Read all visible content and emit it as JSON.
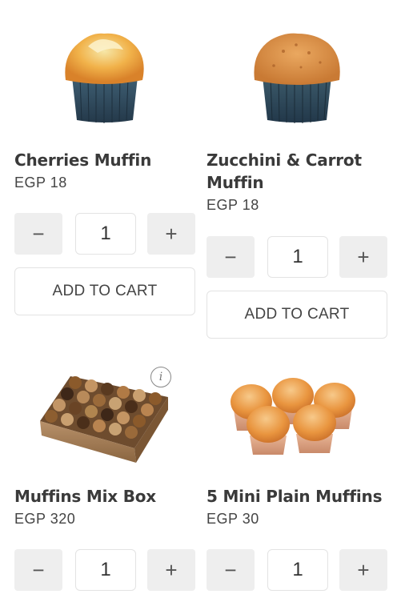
{
  "products": [
    {
      "name": "Cherries Muffin",
      "price": "EGP 18",
      "quantity": "1",
      "minus_icon": "minus-icon",
      "plus_icon": "plus-icon",
      "add_label": "ADD TO CART"
    },
    {
      "name": "Zucchini & Carrot Muffin",
      "price": "EGP 18",
      "quantity": "1",
      "minus_icon": "minus-icon",
      "plus_icon": "plus-icon",
      "add_label": "ADD TO CART"
    },
    {
      "name": "Muffins Mix Box",
      "price": "EGP 320",
      "quantity": "1",
      "info_icon": "info-icon",
      "minus_icon": "minus-icon",
      "plus_icon": "plus-icon"
    },
    {
      "name": "5 Mini Plain Muffins",
      "price": "EGP 30",
      "quantity": "1",
      "minus_icon": "minus-icon",
      "plus_icon": "plus-icon"
    }
  ],
  "icons": {
    "minus_glyph": "−",
    "plus_glyph": "+",
    "info_glyph": "i"
  },
  "colors": {
    "button_bg": "#eeeeee",
    "border": "#e3e3e3",
    "text": "#3a3a3a"
  }
}
